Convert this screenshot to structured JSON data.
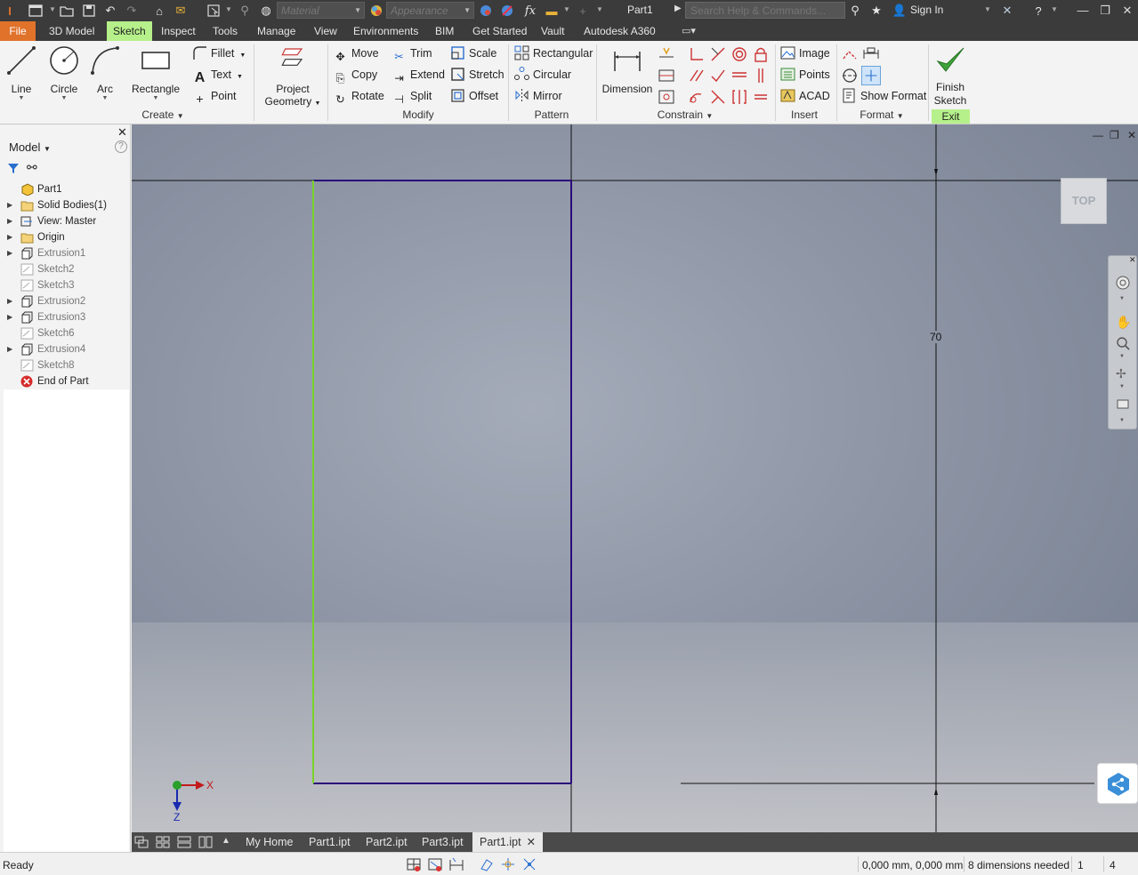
{
  "titlebar": {
    "material_placeholder": "Material",
    "appearance_placeholder": "Appearance",
    "doc_title": "Part1",
    "search_placeholder": "Search Help & Commands...",
    "sign_in": "Sign In"
  },
  "menu": {
    "tabs": [
      "File",
      "3D Model",
      "Sketch",
      "Inspect",
      "Tools",
      "Manage",
      "View",
      "Environments",
      "BIM",
      "Get Started",
      "Vault",
      "Autodesk A360"
    ],
    "active": "Sketch"
  },
  "ribbon": {
    "create": {
      "line": "Line",
      "circle": "Circle",
      "arc": "Arc",
      "rectangle": "Rectangle",
      "fillet": "Fillet",
      "text": "Text",
      "point": "Point",
      "label": "Create"
    },
    "project_geometry": {
      "line1": "Project",
      "line2": "Geometry"
    },
    "modify": {
      "move": "Move",
      "copy": "Copy",
      "rotate": "Rotate",
      "trim": "Trim",
      "extend": "Extend",
      "split": "Split",
      "scale": "Scale",
      "stretch": "Stretch",
      "offset": "Offset",
      "label": "Modify"
    },
    "pattern": {
      "rectangular": "Rectangular",
      "circular": "Circular",
      "mirror": "Mirror",
      "label": "Pattern"
    },
    "constrain": {
      "dimension": "Dimension",
      "label": "Constrain"
    },
    "insert": {
      "image": "Image",
      "points": "Points",
      "acad": "ACAD",
      "label": "Insert"
    },
    "format": {
      "show_format": "Show Format",
      "label": "Format"
    },
    "exit": {
      "finish_line1": "Finish",
      "finish_line2": "Sketch",
      "label": "Exit"
    }
  },
  "browser": {
    "title": "Model",
    "items": [
      {
        "label": "Part1",
        "icon": "part-icon",
        "expandable": false,
        "dim": false
      },
      {
        "label": "Solid Bodies(1)",
        "icon": "folder-icon",
        "expandable": true,
        "dim": false
      },
      {
        "label": "View: Master",
        "icon": "view-icon",
        "expandable": true,
        "dim": false
      },
      {
        "label": "Origin",
        "icon": "folder-icon",
        "expandable": true,
        "dim": false
      },
      {
        "label": "Extrusion1",
        "icon": "extrusion-icon",
        "expandable": true,
        "dim": true
      },
      {
        "label": "Sketch2",
        "icon": "sketch-icon",
        "expandable": false,
        "dim": true
      },
      {
        "label": "Sketch3",
        "icon": "sketch-icon",
        "expandable": false,
        "dim": true
      },
      {
        "label": "Extrusion2",
        "icon": "extrusion-icon",
        "expandable": true,
        "dim": true
      },
      {
        "label": "Extrusion3",
        "icon": "extrusion-icon",
        "expandable": true,
        "dim": true
      },
      {
        "label": "Sketch6",
        "icon": "sketch-icon",
        "expandable": false,
        "dim": true
      },
      {
        "label": "Extrusion4",
        "icon": "extrusion-icon",
        "expandable": true,
        "dim": true
      },
      {
        "label": "Sketch8",
        "icon": "sketch-icon",
        "expandable": false,
        "dim": true
      },
      {
        "label": "End of Part",
        "icon": "end-of-part-icon",
        "expandable": false,
        "dim": false
      }
    ]
  },
  "canvas": {
    "dimension_value": "70",
    "viewcube_face": "TOP",
    "axis_x": "X",
    "axis_z": "Z",
    "colors": {
      "sketch_line": "#2a0a7a",
      "constrained_line": "#7ad22a",
      "dimension_line": "#111111"
    }
  },
  "doc_tabs": {
    "tabs": [
      "My Home",
      "Part1.ipt",
      "Part2.ipt",
      "Part3.ipt",
      "Part1.ipt"
    ],
    "active_index": 4
  },
  "status": {
    "ready": "Ready",
    "coords": "0,000 mm, 0,000 mm",
    "dims_needed": "8 dimensions needed",
    "count1": "1",
    "count2": "4"
  }
}
